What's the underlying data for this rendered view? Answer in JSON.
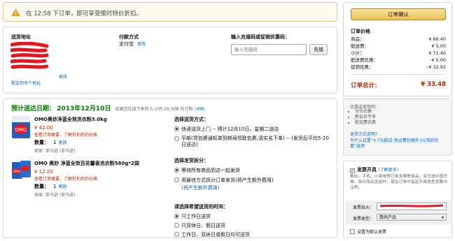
{
  "alert": {
    "text": "在 12:58 下订单，即可享受限时特价折扣。"
  },
  "address": {
    "title": "送货地址",
    "link": "更改",
    "add_link": "配送到多个地址"
  },
  "payment": {
    "title": "付款方式",
    "value": "支付宝",
    "change": "更改"
  },
  "coupon": {
    "title": "输入充值码或促销优惠码：",
    "placeholder": "输入充值码",
    "button": "兑现",
    "btn_label": "充值"
  },
  "delivery": {
    "estimate_label": "预计送达日期：",
    "date": "2013年12月10日",
    "note": "如果您在接下来的 5 小时 28 分钟 内订购",
    "details": "(详情)"
  },
  "items": [
    {
      "name": "OMO奥妙净蓝全效洗衣粉3.0kg",
      "price": "¥ 42.00",
      "price_note": "查看订单概要，了解折扣后的价格",
      "qty_label": "数量：",
      "qty": "1",
      "qty_change": "更改",
      "seller": "卖家: 亚马逊 (亚马逊)"
    },
    {
      "name": "OMO 奥妙 净蓝全效百花馨香洗衣粉560g*2袋",
      "price": "¥ 12.20",
      "price_note": "查看订单概要，了解折扣后的价格",
      "qty_label": "数量：",
      "qty": "1",
      "qty_change": "更改",
      "seller": "卖家: 亚马逊 (亚马逊)"
    }
  ],
  "shipping": {
    "title": "选择送货方式：",
    "options": [
      {
        "label": "快递送货上门 -- 预计12月10日，星期二送达",
        "selected": true
      },
      {
        "label": "平邮(凭包裹通知单到邮局领取包裹,请实名下单) -- (发货后平均5-20日送达)",
        "selected": false
      }
    ]
  },
  "split": {
    "title": "选择发货拆分：",
    "options": [
      {
        "label": "等待所有商品到达一起发货",
        "selected": true
      },
      {
        "label": "用最快方式拆分订单发货(将产生额外费用)",
        "selected": false
      }
    ],
    "extra_link": "(将产生额外费用)"
  },
  "time": {
    "title": "请选择希望送货的时间：",
    "options": [
      {
        "label": "只工作日送货",
        "selected": true
      },
      {
        "label": "只双休日、假日送货",
        "selected": false
      },
      {
        "label": "工作日、双休日或假日均可送货",
        "selected": false
      }
    ]
  },
  "summary": {
    "button": "订单确认",
    "title": "订单价格",
    "rows": [
      {
        "label": "商品：",
        "value": "¥ 66.40"
      },
      {
        "label": "配送费：",
        "value": "¥ 5.00"
      },
      {
        "label": "小计：",
        "value": "¥ 71.40"
      },
      {
        "label": "配送费优惠：",
        "value": "-¥ 5.00"
      },
      {
        "label": "促销优惠：",
        "value": "-¥ 32.92"
      }
    ],
    "total_label": "订单总计：",
    "total_value": "¥ 33.48"
  },
  "promo": {
    "applied_title": "优惠或者限制：",
    "list": [
      "分包必备",
      "新会员专享",
      "配送费优惠"
    ],
    "link1": "退货方式说明?",
    "link2": "为什么设置“4.7元配送-免运费包额外3元钱的优惠”选项"
  },
  "invoice": {
    "title": "发票开具",
    "learn": "(了解更多)",
    "text": "数码、手机、小家电等订单发票是商品，亚马逊中国开具，除日用品全部外，需在订单中指定开具类型发票中注明。",
    "head_label": "发票抬头：",
    "type_label": "发票类型：",
    "type_value": "数码产品",
    "default": "设置为默认发票"
  }
}
